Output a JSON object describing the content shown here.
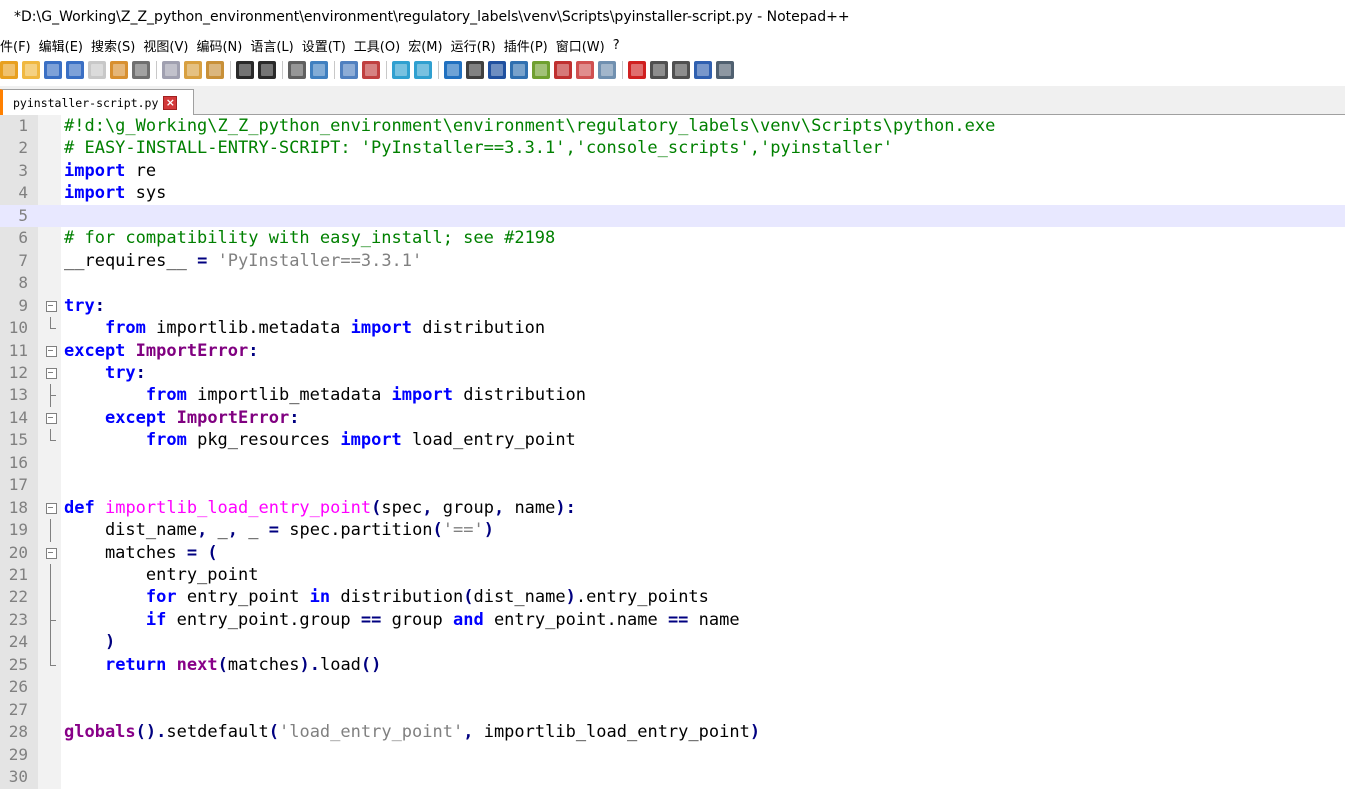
{
  "window": {
    "title": "*D:\\G_Working\\Z_Z_python_environment\\environment\\regulatory_labels\\venv\\Scripts\\pyinstaller-script.py - Notepad++"
  },
  "menu": [
    "件(F)",
    "编辑(E)",
    "搜索(S)",
    "视图(V)",
    "编码(N)",
    "语言(L)",
    "设置(T)",
    "工具(O)",
    "宏(M)",
    "运行(R)",
    "插件(P)",
    "窗口(W)",
    "?"
  ],
  "toolbar": [
    {
      "icon": "new-file-icon",
      "color": "#e8a020"
    },
    {
      "icon": "open-file-icon",
      "color": "#f0b840"
    },
    {
      "icon": "save-icon",
      "color": "#3a6fc4"
    },
    {
      "icon": "save-all-icon",
      "color": "#3a6fc4"
    },
    {
      "icon": "close-icon",
      "color": "#c8c8c8"
    },
    {
      "icon": "close-all-icon",
      "color": "#d89030"
    },
    {
      "icon": "print-icon",
      "color": "#707070"
    },
    {
      "sep": true
    },
    {
      "icon": "cut-icon",
      "color": "#a0a0b0"
    },
    {
      "icon": "copy-icon",
      "color": "#d8a040"
    },
    {
      "icon": "paste-icon",
      "color": "#c89038"
    },
    {
      "sep": true
    },
    {
      "icon": "undo-icon",
      "color": "#2a2a2a"
    },
    {
      "icon": "redo-icon",
      "color": "#2a2a2a"
    },
    {
      "sep": true
    },
    {
      "icon": "find-icon",
      "color": "#606060"
    },
    {
      "icon": "replace-icon",
      "color": "#4080c0"
    },
    {
      "sep": true
    },
    {
      "icon": "zoom-in-icon",
      "color": "#5080c0"
    },
    {
      "icon": "zoom-out-icon",
      "color": "#c04040"
    },
    {
      "sep": true
    },
    {
      "icon": "sync-vertical-icon",
      "color": "#30a0d0"
    },
    {
      "icon": "sync-horizontal-icon",
      "color": "#30a0d0"
    },
    {
      "sep": true
    },
    {
      "icon": "word-wrap-icon",
      "color": "#2070c0"
    },
    {
      "icon": "show-all-chars-icon",
      "color": "#404040"
    },
    {
      "icon": "indent-guide-icon",
      "color": "#2050a0"
    },
    {
      "icon": "user-language-icon",
      "color": "#3070b0"
    },
    {
      "icon": "document-map-icon",
      "color": "#70a030"
    },
    {
      "icon": "function-list-icon",
      "color": "#c03030"
    },
    {
      "icon": "folder-workspace-icon",
      "color": "#d05050"
    },
    {
      "icon": "monitoring-icon",
      "color": "#7090b0"
    },
    {
      "sep": true
    },
    {
      "icon": "record-macro-icon",
      "color": "#d02020"
    },
    {
      "icon": "stop-macro-icon",
      "color": "#505050"
    },
    {
      "icon": "play-macro-icon",
      "color": "#505050"
    },
    {
      "icon": "run-macro-multiple-icon",
      "color": "#3060b0"
    },
    {
      "icon": "save-macro-icon",
      "color": "#506070"
    }
  ],
  "tab": {
    "label": "pyinstaller-script.py"
  },
  "editor": {
    "current_line": 5,
    "lines": [
      {
        "n": "1",
        "fold": "",
        "tokens": [
          {
            "t": "#!d:\\g_Working\\Z_Z_python_environment\\environment\\regulatory_labels\\venv\\Scripts\\python.exe",
            "c": "cm"
          }
        ]
      },
      {
        "n": "2",
        "fold": "",
        "tokens": [
          {
            "t": "# EASY-INSTALL-ENTRY-SCRIPT: 'PyInstaller==3.3.1','console_scripts','pyinstaller'",
            "c": "cm"
          }
        ]
      },
      {
        "n": "3",
        "fold": "",
        "tokens": [
          {
            "t": "import",
            "c": "kw"
          },
          {
            "t": " re",
            "c": "id"
          }
        ]
      },
      {
        "n": "4",
        "fold": "",
        "tokens": [
          {
            "t": "import",
            "c": "kw"
          },
          {
            "t": " sys",
            "c": "id"
          }
        ]
      },
      {
        "n": "5",
        "fold": "",
        "tokens": []
      },
      {
        "n": "6",
        "fold": "",
        "tokens": [
          {
            "t": "# for compatibility with easy_install; see #2198",
            "c": "cm"
          }
        ]
      },
      {
        "n": "7",
        "fold": "",
        "tokens": [
          {
            "t": "__requires__ ",
            "c": "id"
          },
          {
            "t": "=",
            "c": "op"
          },
          {
            "t": " ",
            "c": "id"
          },
          {
            "t": "'PyInstaller==3.3.1'",
            "c": "str"
          }
        ]
      },
      {
        "n": "8",
        "fold": "",
        "tokens": []
      },
      {
        "n": "9",
        "fold": "box",
        "tokens": [
          {
            "t": "try",
            "c": "kw"
          },
          {
            "t": ":",
            "c": "op"
          }
        ]
      },
      {
        "n": "10",
        "fold": "end",
        "tokens": [
          {
            "t": "    ",
            "c": "id"
          },
          {
            "t": "from",
            "c": "kw"
          },
          {
            "t": " importlib.metadata ",
            "c": "id"
          },
          {
            "t": "import",
            "c": "kw"
          },
          {
            "t": " distribution",
            "c": "id"
          }
        ]
      },
      {
        "n": "11",
        "fold": "box",
        "tokens": [
          {
            "t": "except",
            "c": "kw"
          },
          {
            "t": " ",
            "c": "id"
          },
          {
            "t": "ImportError",
            "c": "cls"
          },
          {
            "t": ":",
            "c": "op"
          }
        ]
      },
      {
        "n": "12",
        "fold": "box",
        "tokens": [
          {
            "t": "    ",
            "c": "id"
          },
          {
            "t": "try",
            "c": "kw"
          },
          {
            "t": ":",
            "c": "op"
          }
        ]
      },
      {
        "n": "13",
        "fold": "mid",
        "tokens": [
          {
            "t": "        ",
            "c": "id"
          },
          {
            "t": "from",
            "c": "kw"
          },
          {
            "t": " importlib_metadata ",
            "c": "id"
          },
          {
            "t": "import",
            "c": "kw"
          },
          {
            "t": " distribution",
            "c": "id"
          }
        ]
      },
      {
        "n": "14",
        "fold": "box",
        "tokens": [
          {
            "t": "    ",
            "c": "id"
          },
          {
            "t": "except",
            "c": "kw"
          },
          {
            "t": " ",
            "c": "id"
          },
          {
            "t": "ImportError",
            "c": "cls"
          },
          {
            "t": ":",
            "c": "op"
          }
        ]
      },
      {
        "n": "15",
        "fold": "end",
        "tokens": [
          {
            "t": "        ",
            "c": "id"
          },
          {
            "t": "from",
            "c": "kw"
          },
          {
            "t": " pkg_resources ",
            "c": "id"
          },
          {
            "t": "import",
            "c": "kw"
          },
          {
            "t": " load_entry_point",
            "c": "id"
          }
        ]
      },
      {
        "n": "16",
        "fold": "",
        "tokens": []
      },
      {
        "n": "17",
        "fold": "",
        "tokens": []
      },
      {
        "n": "18",
        "fold": "box",
        "tokens": [
          {
            "t": "def",
            "c": "kw"
          },
          {
            "t": " ",
            "c": "id"
          },
          {
            "t": "importlib_load_entry_point",
            "c": "fn"
          },
          {
            "t": "(",
            "c": "op"
          },
          {
            "t": "spec",
            "c": "id"
          },
          {
            "t": ",",
            "c": "op"
          },
          {
            "t": " group",
            "c": "id"
          },
          {
            "t": ",",
            "c": "op"
          },
          {
            "t": " name",
            "c": "id"
          },
          {
            "t": "):",
            "c": "op"
          }
        ]
      },
      {
        "n": "19",
        "fold": "bar",
        "tokens": [
          {
            "t": "    dist_name",
            "c": "id"
          },
          {
            "t": ",",
            "c": "op"
          },
          {
            "t": " _",
            "c": "id"
          },
          {
            "t": ",",
            "c": "op"
          },
          {
            "t": " _ ",
            "c": "id"
          },
          {
            "t": "=",
            "c": "op"
          },
          {
            "t": " spec.partition",
            "c": "id"
          },
          {
            "t": "(",
            "c": "op"
          },
          {
            "t": "'=='",
            "c": "str"
          },
          {
            "t": ")",
            "c": "op"
          }
        ]
      },
      {
        "n": "20",
        "fold": "box",
        "tokens": [
          {
            "t": "    matches ",
            "c": "id"
          },
          {
            "t": "=",
            "c": "op"
          },
          {
            "t": " ",
            "c": "id"
          },
          {
            "t": "(",
            "c": "op"
          }
        ]
      },
      {
        "n": "21",
        "fold": "bar",
        "tokens": [
          {
            "t": "        entry_point",
            "c": "id"
          }
        ]
      },
      {
        "n": "22",
        "fold": "bar",
        "tokens": [
          {
            "t": "        ",
            "c": "id"
          },
          {
            "t": "for",
            "c": "kw"
          },
          {
            "t": " entry_point ",
            "c": "id"
          },
          {
            "t": "in",
            "c": "kw"
          },
          {
            "t": " distribution",
            "c": "id"
          },
          {
            "t": "(",
            "c": "op"
          },
          {
            "t": "dist_name",
            "c": "id"
          },
          {
            "t": ")",
            "c": "op"
          },
          {
            "t": ".entry_points",
            "c": "id"
          }
        ]
      },
      {
        "n": "23",
        "fold": "mid",
        "tokens": [
          {
            "t": "        ",
            "c": "id"
          },
          {
            "t": "if",
            "c": "kw"
          },
          {
            "t": " entry_point.group ",
            "c": "id"
          },
          {
            "t": "==",
            "c": "op"
          },
          {
            "t": " group ",
            "c": "id"
          },
          {
            "t": "and",
            "c": "kw"
          },
          {
            "t": " entry_point.name ",
            "c": "id"
          },
          {
            "t": "==",
            "c": "op"
          },
          {
            "t": " name",
            "c": "id"
          }
        ]
      },
      {
        "n": "24",
        "fold": "bar",
        "tokens": [
          {
            "t": "    ",
            "c": "id"
          },
          {
            "t": ")",
            "c": "op"
          }
        ]
      },
      {
        "n": "25",
        "fold": "end",
        "tokens": [
          {
            "t": "    ",
            "c": "id"
          },
          {
            "t": "return",
            "c": "kw"
          },
          {
            "t": " ",
            "c": "id"
          },
          {
            "t": "next",
            "c": "bi"
          },
          {
            "t": "(",
            "c": "op"
          },
          {
            "t": "matches",
            "c": "id"
          },
          {
            "t": ").",
            "c": "op"
          },
          {
            "t": "load",
            "c": "id"
          },
          {
            "t": "()",
            "c": "op"
          }
        ]
      },
      {
        "n": "26",
        "fold": "",
        "tokens": []
      },
      {
        "n": "27",
        "fold": "",
        "tokens": []
      },
      {
        "n": "28",
        "fold": "",
        "tokens": [
          {
            "t": "globals",
            "c": "bi"
          },
          {
            "t": "().",
            "c": "op"
          },
          {
            "t": "setdefault",
            "c": "id"
          },
          {
            "t": "(",
            "c": "op"
          },
          {
            "t": "'load_entry_point'",
            "c": "str"
          },
          {
            "t": ",",
            "c": "op"
          },
          {
            "t": " importlib_load_entry_point",
            "c": "id"
          },
          {
            "t": ")",
            "c": "op"
          }
        ]
      },
      {
        "n": "29",
        "fold": "",
        "tokens": []
      },
      {
        "n": "30",
        "fold": "",
        "tokens": []
      }
    ]
  }
}
